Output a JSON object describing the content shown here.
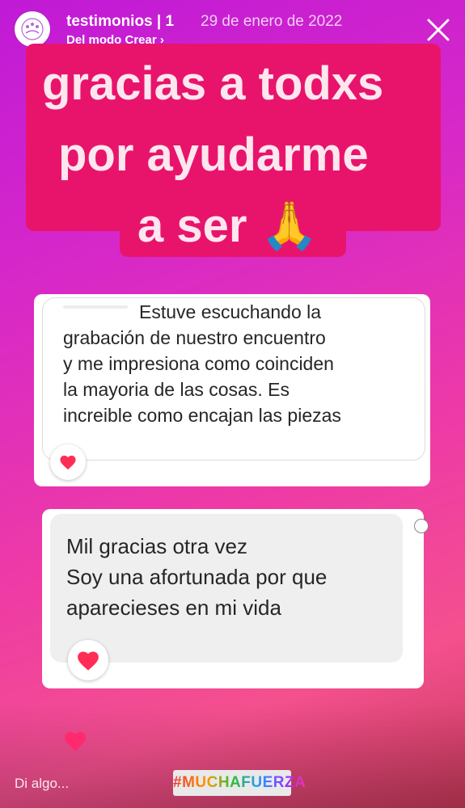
{
  "colors": {
    "title_bg": "#e8146c",
    "title_text": "#fde6ee",
    "heart": "#ff2d55"
  },
  "header": {
    "account": "testimonios | 1",
    "date": "29 de enero de 2022",
    "source": "Del modo Crear ›"
  },
  "title": {
    "line1": "gracias a todxs",
    "line2": "por ayudarme",
    "line3": "a ser 🙏"
  },
  "messages": [
    {
      "lines": [
        "Estuve escuchando la",
        "grabación de nuestro encuentro",
        "y me impresiona como coinciden",
        "la mayoria de las cosas. Es",
        "increible como encajan las piezas"
      ],
      "reaction": "heart-icon"
    },
    {
      "lines": [
        "Mil gracias otra vez",
        "Soy una afortunada por que",
        "aparecieses en mi vida"
      ],
      "reaction": "heart-icon"
    }
  ],
  "footer": {
    "reply_placeholder": "Di algo...",
    "hashtag": "#MUCHAFUERZA"
  }
}
